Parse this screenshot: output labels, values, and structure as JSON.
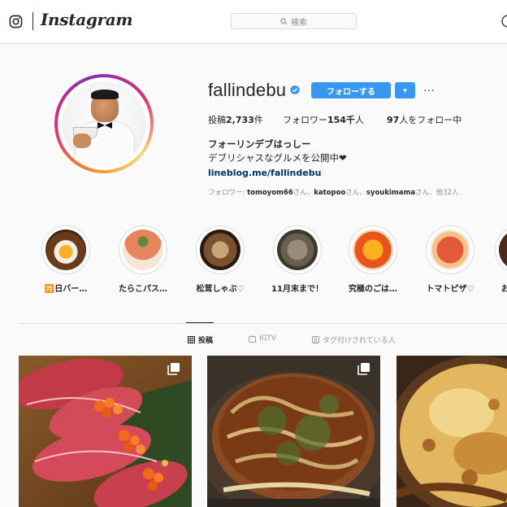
{
  "header": {
    "wordmark": "Instagram",
    "search_placeholder": "検索"
  },
  "profile": {
    "username": "fallindebu",
    "follow_label": "フォローする",
    "dropdown_label": "▾",
    "more_label": "···",
    "stats": {
      "posts_label": "投稿",
      "posts_value": "2,733",
      "posts_unit": "件",
      "followers_label": "フォロワー",
      "followers_value": "154千",
      "followers_unit": "人",
      "following_value": "97",
      "following_text": "人をフォロー中"
    },
    "full_name": "フォーリンデブはっしー",
    "bio": "デブリシャスなグルメを公開中❤",
    "link": "lineblog.me/fallindebu",
    "followed_by": {
      "prefix": "フォロワー: ",
      "user1": "tomoyom66",
      "sep1": "さん、",
      "user2": "katopoo",
      "sep2": "さん、",
      "user3": "syoukimama",
      "sep3": "さん、他32人"
    }
  },
  "highlights": [
    {
      "label": "🈷️日バー…"
    },
    {
      "label": "たらこパス…"
    },
    {
      "label": "松茸しゃぶ♡"
    },
    {
      "label": "11月末まで！"
    },
    {
      "label": "究極のごは…"
    },
    {
      "label": "トマトピザ♡"
    },
    {
      "label": "お"
    }
  ],
  "tabs": [
    {
      "label": "投稿",
      "icon": "grid-icon",
      "active": true
    },
    {
      "label": "IGTV",
      "icon": "igtv-icon",
      "active": false
    },
    {
      "label": "タグ付けされている人",
      "icon": "tagged-icon",
      "active": false
    }
  ],
  "colors": {
    "accent": "#3897f0",
    "verified": "#3897f0",
    "link": "#003569",
    "border": "#dbdbdb",
    "muted": "#8e8e8e"
  }
}
